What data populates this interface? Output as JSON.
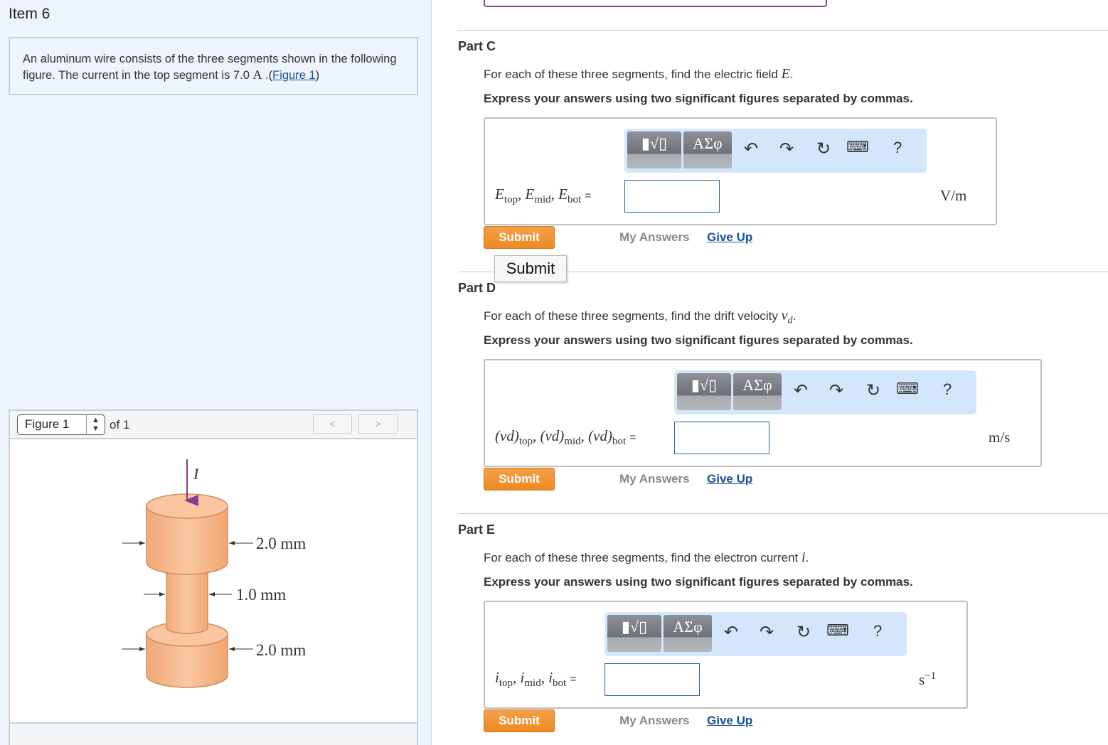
{
  "item_title": "Item 6",
  "problem": {
    "text": "An aluminum wire consists of the three segments shown in the following figure. The current in the top segment is 7.0",
    "unit": "A",
    "sep": " .(",
    "link": "Figure 1",
    "close": ")"
  },
  "figure_nav": {
    "selected": "Figure 1",
    "of_text": "of 1",
    "prev": "<",
    "next": ">"
  },
  "figure": {
    "current_label": "I",
    "top_dim": "2.0 mm",
    "mid_dim": "1.0 mm",
    "bot_dim": "2.0 mm",
    "cylinder_color": "#f7b98a",
    "arrow_color": "#8a3a8f"
  },
  "toolbar": {
    "template_label": "▮√▯",
    "symbols_label": "ΑΣφ",
    "undo_icon": "↶",
    "redo_icon": "↷",
    "reset_icon": "↻",
    "keyboard_icon": "⌨",
    "help": "?"
  },
  "actions": {
    "submit": "Submit",
    "my_answers": "My Answers",
    "give_up": "Give Up"
  },
  "tooltip": "Submit",
  "parts": {
    "c": {
      "title": "Part C",
      "prompt": "For each of these three segments, find the electric field",
      "symbol": "E",
      "end": ".",
      "instruction": "Express your answers using two significant figures separated by commas.",
      "label_vars": [
        "E",
        "E",
        "E"
      ],
      "label_subs": [
        "top",
        "mid",
        "bot"
      ],
      "equals": "=",
      "value": "",
      "unit": "V/m"
    },
    "d": {
      "title": "Part D",
      "prompt": "For each of these three segments, find the drift velocity",
      "symbol": "v",
      "symbol_sub": "d",
      "end": ".",
      "instruction": "Express your answers using two significant figures separated by commas.",
      "label_vars": [
        "(vd)",
        "(vd)",
        "(vd)"
      ],
      "label_subs": [
        "top",
        "mid",
        "bot"
      ],
      "equals": "=",
      "value": "",
      "unit": "m/s"
    },
    "e": {
      "title": "Part E",
      "prompt": "For each of these three segments, find the electron current",
      "symbol": "i",
      "end": ".",
      "instruction": "Express your answers using two significant figures separated by commas.",
      "label_vars": [
        "i",
        "i",
        "i"
      ],
      "label_subs": [
        "top",
        "mid",
        "bot"
      ],
      "equals": "=",
      "value": "",
      "unit": "s",
      "unit_sup": "−1"
    }
  }
}
